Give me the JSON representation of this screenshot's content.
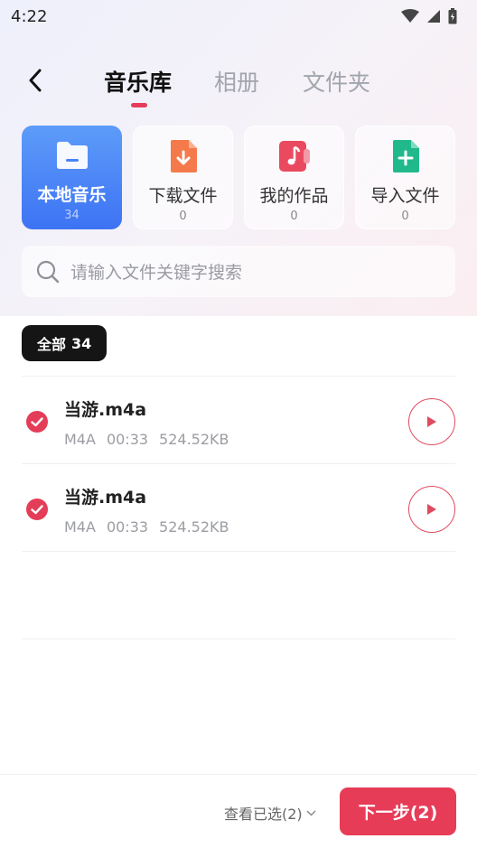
{
  "status_bar": {
    "time": "4:22"
  },
  "nav": {
    "tabs": [
      {
        "label": "音乐库",
        "active": true
      },
      {
        "label": "相册",
        "active": false
      },
      {
        "label": "文件夹",
        "active": false
      }
    ]
  },
  "categories": [
    {
      "label": "本地音乐",
      "count": "34",
      "icon": "folder-icon",
      "color": "#ffffff"
    },
    {
      "label": "下载文件",
      "count": "0",
      "icon": "download-file-icon",
      "color": "#f47a4c"
    },
    {
      "label": "我的作品",
      "count": "0",
      "icon": "music-note-icon",
      "color": "#ea4a5f"
    },
    {
      "label": "导入文件",
      "count": "0",
      "icon": "add-file-icon",
      "color": "#21b98c"
    }
  ],
  "search": {
    "placeholder": "请输入文件关键字搜索"
  },
  "filter": {
    "label": "全部",
    "count": "34"
  },
  "files": [
    {
      "name": "当游.m4a",
      "format": "M4A",
      "duration": "00:33",
      "size": "524.52KB",
      "selected": true
    },
    {
      "name": "当游.m4a",
      "format": "M4A",
      "duration": "00:33",
      "size": "524.52KB",
      "selected": true
    }
  ],
  "bottom": {
    "view_selected": "查看已选(2)",
    "next_label": "下一步(2)"
  },
  "colors": {
    "accent": "#e63c57",
    "active_category": "#4a84f6"
  }
}
